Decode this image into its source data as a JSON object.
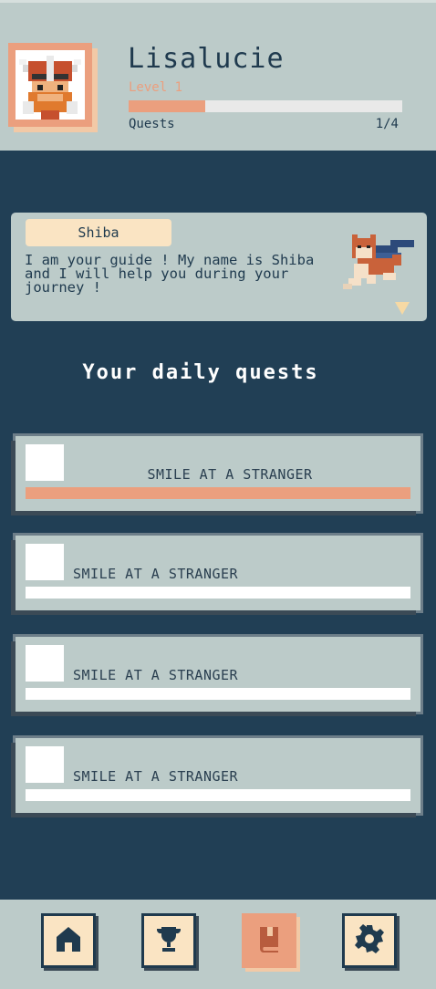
{
  "profile": {
    "username": "Lisalucie",
    "level_label": "Level 1",
    "xp_progress": 0.28,
    "quests_label": "Quests",
    "quests_count": "1/4"
  },
  "guide": {
    "name": "Shiba",
    "message": "I am your guide ! My name is Shiba and I will help you during your journey !"
  },
  "daily": {
    "title": "Your daily quests"
  },
  "quests": [
    {
      "label": "SMILE AT A STRANGER",
      "progress": 1.0
    },
    {
      "label": "SMILE AT A STRANGER",
      "progress": 0.0
    },
    {
      "label": "SMILE AT A STRANGER",
      "progress": 0.0
    },
    {
      "label": "SMILE AT A STRANGER",
      "progress": 0.0
    }
  ],
  "nav": [
    {
      "icon": "home-icon",
      "active": false
    },
    {
      "icon": "trophy-icon",
      "active": false
    },
    {
      "icon": "book-icon",
      "active": true
    },
    {
      "icon": "gear-icon",
      "active": false
    }
  ],
  "colors": {
    "background": "#213f55",
    "panel": "#bccbc9",
    "accent": "#eb9f7e",
    "cream": "#fae4c3",
    "dark": "#1f3a4e"
  }
}
